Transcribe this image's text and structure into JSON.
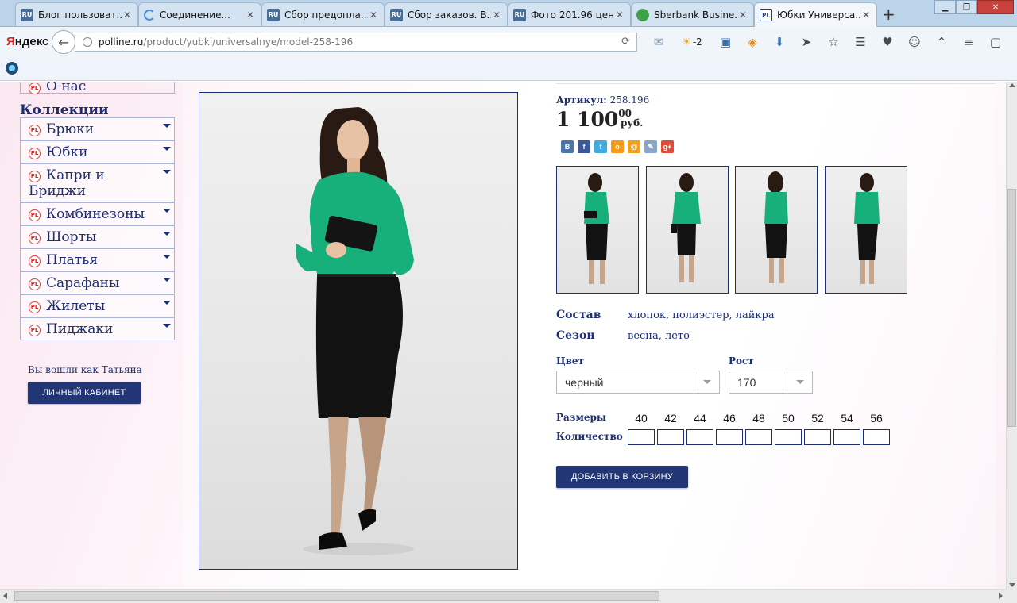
{
  "browser": {
    "tabs": [
      {
        "label": "Блог пользоват...",
        "icon": "ru-favicon-icon",
        "close": "✕"
      },
      {
        "label": "Соединение...",
        "icon": "loading-spinner-icon",
        "close": "✕"
      },
      {
        "label": "Сбор предопла...",
        "icon": "ru-favicon-icon",
        "close": "✕"
      },
      {
        "label": "Сбор заказов. В...",
        "icon": "ru-favicon-icon",
        "close": "✕"
      },
      {
        "label": "Фото 201.96 цен...",
        "icon": "ru-favicon-icon",
        "close": "✕"
      },
      {
        "label": "Sberbank Busine...",
        "icon": "sberbank-favicon-icon",
        "close": "✕"
      },
      {
        "label": "Юбки Универса...",
        "icon": "polline-favicon-icon",
        "close": "✕",
        "active": true
      }
    ],
    "favicon_ru": "RU",
    "favicon_pl": "PL",
    "new_tab": "+",
    "brand": "Яндекс",
    "brand_first": "Я",
    "brand_rest": "ндекс",
    "url_host": "polline.ru",
    "url_path": "/product/yubki/universalnye/model-258-196",
    "weather_temp": "-2"
  },
  "sidebar": {
    "about": "О нас",
    "collections_title": "Коллекции",
    "items": [
      {
        "label": "Брюки"
      },
      {
        "label": "Юбки"
      },
      {
        "label": "Капри и Бриджи"
      },
      {
        "label": "Комбинезоны"
      },
      {
        "label": "Шорты"
      },
      {
        "label": "Платья"
      },
      {
        "label": "Сарафаны"
      },
      {
        "label": "Жилеты"
      },
      {
        "label": "Пиджаки"
      }
    ],
    "logged_in_text": "Вы вошли как Татьяна",
    "cabinet_button": "ЛИЧНЫЙ КАБИНЕТ"
  },
  "product": {
    "sku_label": "Артикул:",
    "sku_value": "258.196",
    "price_main": "1 100",
    "price_cents": "00",
    "currency": "руб.",
    "composition_label": "Состав",
    "composition_value": "хлопок, полиэстер, лайкра",
    "season_label": "Сезон",
    "season_value": "весна, лето",
    "color_label": "Цвет",
    "color_value": "черный",
    "height_label": "Рост",
    "height_value": "170",
    "sizes_label": "Размеры",
    "quantity_label": "Количество",
    "sizes": [
      "40",
      "42",
      "44",
      "46",
      "48",
      "50",
      "52",
      "54",
      "56"
    ],
    "add_to_cart": "ДОБАВИТЬ В КОРЗИНУ"
  },
  "share_icons": [
    {
      "name": "vkontakte-icon",
      "glyph": "B",
      "color": "#4a76a8"
    },
    {
      "name": "facebook-icon",
      "glyph": "f",
      "color": "#3b5998"
    },
    {
      "name": "twitter-icon",
      "glyph": "t",
      "color": "#41abe1"
    },
    {
      "name": "odnoklassniki-icon",
      "glyph": "о",
      "color": "#f59a1d"
    },
    {
      "name": "mailru-icon",
      "glyph": "@",
      "color": "#f0a21c"
    },
    {
      "name": "livejournal-icon",
      "glyph": "✎",
      "color": "#8aa7c9"
    },
    {
      "name": "googleplus-icon",
      "glyph": "g+",
      "color": "#dd4b39"
    }
  ],
  "colors": {
    "brand_navy": "#1d2e73",
    "button_navy": "#223676",
    "blouse_green": "#17b07a",
    "skirt_black": "#121212"
  }
}
